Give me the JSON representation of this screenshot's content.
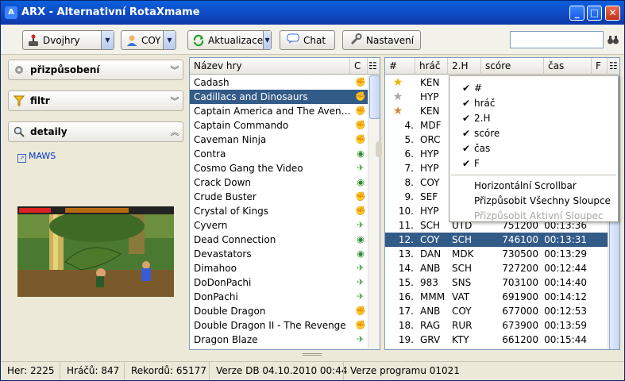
{
  "window": {
    "title": "ARX - Alternativní RotaXmame",
    "app_icon": "arx-icon",
    "controls": {
      "minimize": "minimize-icon",
      "maximize": "maximize-icon",
      "close": "close-icon"
    }
  },
  "toolbar": {
    "mode_combo": {
      "value": "Dvojhry",
      "icon": "joystick-icon"
    },
    "user_combo": {
      "value": "COY",
      "icon": "user-icon"
    },
    "update_button": {
      "label": "Aktualizace",
      "icon": "refresh-icon"
    },
    "chat_button": {
      "label": "Chat",
      "icon": "chat-icon"
    },
    "settings_button": {
      "label": "Nastavení",
      "icon": "wrench-icon"
    },
    "search": {
      "value": "",
      "placeholder": ""
    }
  },
  "sidebar": {
    "customize": {
      "label": "přizpůsobení",
      "icon": "gear-icon",
      "state": "collapsed"
    },
    "filter": {
      "label": "filtr",
      "icon": "funnel-icon",
      "state": "collapsed"
    },
    "details": {
      "label": "detaily",
      "icon": "magnifier-icon",
      "state": "expanded"
    },
    "maws_link": "MAWS"
  },
  "game_list": {
    "columns": {
      "name": "Název hry",
      "c": "C"
    },
    "selected_index": 1,
    "rows": [
      {
        "name": "Cadash",
        "icon": "fighter-icon"
      },
      {
        "name": "Cadillacs and Dinosaurs",
        "icon": "fighter-icon"
      },
      {
        "name": "Captain America and The Avengers",
        "icon": "fighter-icon"
      },
      {
        "name": "Captain Commando",
        "icon": "fighter-icon"
      },
      {
        "name": "Caveman Ninja",
        "icon": "fighter-icon"
      },
      {
        "name": "Contra",
        "icon": "target-icon"
      },
      {
        "name": "Cosmo Gang the Video",
        "icon": "plane-icon"
      },
      {
        "name": "Crack Down",
        "icon": "target-icon"
      },
      {
        "name": "Crude Buster",
        "icon": "fighter-icon"
      },
      {
        "name": "Crystal of Kings",
        "icon": "fighter-icon"
      },
      {
        "name": "Cyvern",
        "icon": "plane-icon"
      },
      {
        "name": "Dead Connection",
        "icon": "target-icon"
      },
      {
        "name": "Devastators",
        "icon": "target-icon"
      },
      {
        "name": "Dimahoo",
        "icon": "plane-icon"
      },
      {
        "name": "DoDonPachi",
        "icon": "plane-icon"
      },
      {
        "name": "DonPachi",
        "icon": "plane-icon"
      },
      {
        "name": "Double Dragon",
        "icon": "fighter-icon"
      },
      {
        "name": "Double Dragon II - The Revenge",
        "icon": "fighter-icon"
      },
      {
        "name": "Dragon Blaze",
        "icon": "plane-icon"
      }
    ]
  },
  "records": {
    "columns": {
      "rank": "#",
      "player": "hráč",
      "second": "2.H",
      "score": "scóre",
      "time": "čas",
      "f": "F"
    },
    "selected_index": 11,
    "rows": [
      {
        "rank": "1.",
        "medal": "gold-star-icon",
        "player": "KEN",
        "second": "",
        "score": "",
        "time": ""
      },
      {
        "rank": "2.",
        "medal": "silver-star-icon",
        "player": "HYP",
        "second": "",
        "score": "",
        "time": ""
      },
      {
        "rank": "3.",
        "medal": "bronze-star-icon",
        "player": "KEN",
        "second": "",
        "score": "",
        "time": ""
      },
      {
        "rank": "4.",
        "medal": "",
        "player": "MDF",
        "second": "",
        "score": "",
        "time": ""
      },
      {
        "rank": "5.",
        "medal": "",
        "player": "ORC",
        "second": "",
        "score": "",
        "time": ""
      },
      {
        "rank": "6.",
        "medal": "",
        "player": "HYP",
        "second": "",
        "score": "",
        "time": ""
      },
      {
        "rank": "7.",
        "medal": "",
        "player": "HYP",
        "second": "",
        "score": "",
        "time": ""
      },
      {
        "rank": "8.",
        "medal": "",
        "player": "COY",
        "second": "",
        "score": "",
        "time": ""
      },
      {
        "rank": "9.",
        "medal": "",
        "player": "SEF",
        "second": "",
        "score": "",
        "time": ""
      },
      {
        "rank": "10.",
        "medal": "",
        "player": "HYP",
        "second": "",
        "score": "",
        "time": ""
      },
      {
        "rank": "11.",
        "medal": "",
        "player": "SCH",
        "second": "UTD",
        "score": "751200",
        "time": "00:13:36"
      },
      {
        "rank": "12.",
        "medal": "",
        "player": "COY",
        "second": "SCH",
        "score": "746100",
        "time": "00:13:31"
      },
      {
        "rank": "13.",
        "medal": "",
        "player": "DAN",
        "second": "MDK",
        "score": "730500",
        "time": "00:13:29"
      },
      {
        "rank": "14.",
        "medal": "",
        "player": "ANB",
        "second": "SCH",
        "score": "727200",
        "time": "00:12:44"
      },
      {
        "rank": "15.",
        "medal": "",
        "player": "983",
        "second": "SNS",
        "score": "703100",
        "time": "00:14:40"
      },
      {
        "rank": "16.",
        "medal": "",
        "player": "MMM",
        "second": "VAT",
        "score": "691900",
        "time": "00:14:12"
      },
      {
        "rank": "17.",
        "medal": "",
        "player": "ANB",
        "second": "COY",
        "score": "677000",
        "time": "00:12:53"
      },
      {
        "rank": "18.",
        "medal": "",
        "player": "RAG",
        "second": "RUR",
        "score": "673900",
        "time": "00:13:59"
      },
      {
        "rank": "19.",
        "medal": "",
        "player": "GRV",
        "second": "KTY",
        "score": "661200",
        "time": "00:15:44"
      }
    ]
  },
  "column_menu": {
    "items": [
      {
        "label": "#",
        "checked": true
      },
      {
        "label": "hráč",
        "checked": true
      },
      {
        "label": "2.H",
        "checked": true
      },
      {
        "label": "scóre",
        "checked": true
      },
      {
        "label": "čas",
        "checked": true
      },
      {
        "label": "F",
        "checked": true
      }
    ],
    "actions": [
      {
        "label": "Horizontální Scrollbar",
        "enabled": true
      },
      {
        "label": "Přizpůsobit Všechny Sloupce",
        "enabled": true
      },
      {
        "label": "Přizpůsobit Aktivní Sloupec",
        "enabled": false
      }
    ]
  },
  "status": {
    "games": "Her: 2225",
    "players": "Hráčů: 847",
    "records": "Rekordů: 65177",
    "db_version": "Verze DB 04.10.2010 00:44",
    "program_version": "Verze programu 01021"
  }
}
